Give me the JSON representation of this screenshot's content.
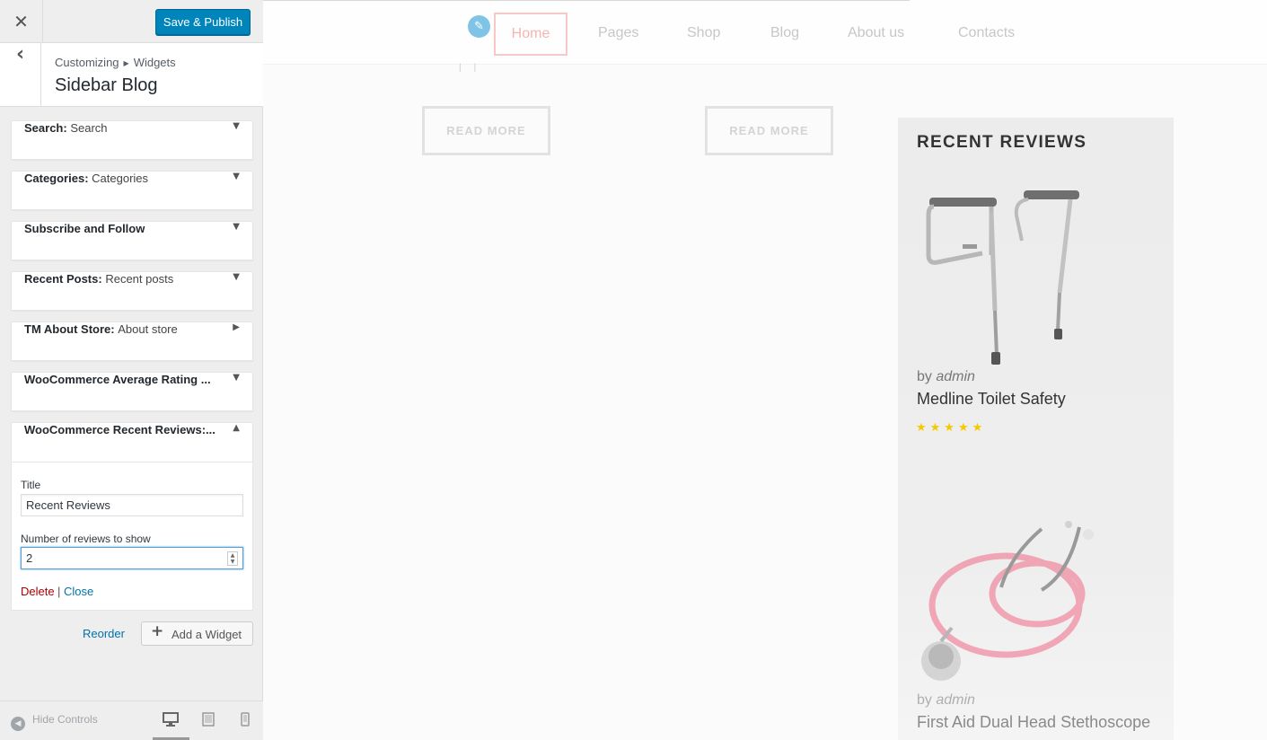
{
  "customizer": {
    "close_icon": "close-icon",
    "save_label": "Save & Publish",
    "breadcrumb": [
      "Customizing",
      "Widgets"
    ],
    "section_title": "Sidebar Blog",
    "widgets": [
      {
        "name": "Search:",
        "subtitle": "Search",
        "arrow": "▼"
      },
      {
        "name": "Categories:",
        "subtitle": "Categories",
        "arrow": "▼"
      },
      {
        "name": "Subscribe and Follow",
        "subtitle": "",
        "arrow": "▼"
      },
      {
        "name": "Recent Posts:",
        "subtitle": "Recent posts",
        "arrow": "▼"
      },
      {
        "name": "TM About Store:",
        "subtitle": "About store",
        "arrow": "▶"
      },
      {
        "name": "WooCommerce Average Rating ...",
        "subtitle": "",
        "arrow": "▼"
      }
    ],
    "expanded_widget": {
      "name": "WooCommerce Recent Reviews:...",
      "arrow": "▲",
      "title_label": "Title",
      "title_value": "Recent Reviews",
      "count_label": "Number of reviews to show",
      "count_value": "2",
      "delete_label": "Delete",
      "separator": "|",
      "close_label": "Close"
    },
    "reorder_label": "Reorder",
    "add_widget_label": "Add a Widget",
    "hide_controls_label": "Hide Controls"
  },
  "preview": {
    "nav": [
      "Home",
      "Pages",
      "Shop",
      "Blog",
      "About us",
      "Contacts"
    ],
    "read_more_label": "READ MORE",
    "reviews_title": "RECENT REVIEWS",
    "reviews": [
      {
        "by": "by",
        "author": "admin",
        "product": "Medline Toilet Safety",
        "rating": 5,
        "stars": "★★★★★"
      },
      {
        "by": "by",
        "author": "admin",
        "product": "First Aid Dual Head Stethoscope"
      }
    ]
  },
  "colors": {
    "primary": "#0085ba",
    "delete": "#aa0000",
    "link": "#0073aa",
    "star": "#f6c800"
  }
}
